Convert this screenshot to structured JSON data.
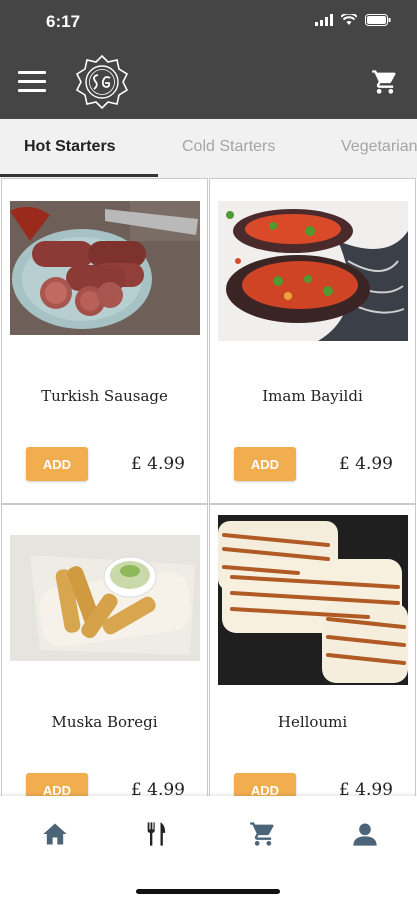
{
  "status": {
    "time": "6:17"
  },
  "tabs": [
    {
      "label": "Hot Starters",
      "active": true
    },
    {
      "label": "Cold Starters",
      "active": false
    },
    {
      "label": "Vegetarian",
      "active": false
    }
  ],
  "products": [
    {
      "name": "Turkish Sausage",
      "add_label": "ADD",
      "price": "£ 4.99"
    },
    {
      "name": "Imam Bayildi",
      "add_label": "ADD",
      "price": "£ 4.99"
    },
    {
      "name": "Muska Boregi",
      "add_label": "ADD",
      "price": "£ 4.99"
    },
    {
      "name": "Helloumi",
      "add_label": "ADD",
      "price": "£ 4.99"
    }
  ],
  "bottom_nav": [
    {
      "icon": "home-icon"
    },
    {
      "icon": "fork-knife-icon"
    },
    {
      "icon": "cart-icon"
    },
    {
      "icon": "user-icon"
    }
  ],
  "colors": {
    "header_bg": "#454545",
    "accent": "#f2ad4e",
    "nav_icon": "#4c6477"
  }
}
